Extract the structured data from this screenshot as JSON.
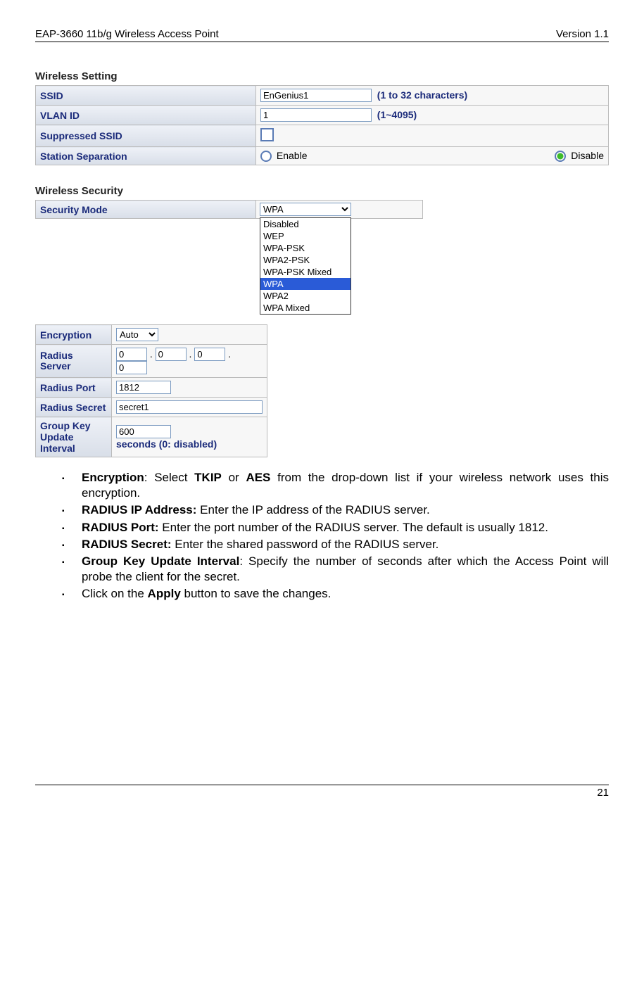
{
  "header": {
    "left": "EAP-3660  11b/g Wireless Access Point",
    "right": "Version 1.1"
  },
  "wireless_setting": {
    "title": "Wireless Setting",
    "ssid_label": "SSID",
    "ssid_value": "EnGenius1",
    "ssid_note": "(1 to 32 characters)",
    "vlan_label": "VLAN ID",
    "vlan_value": "1",
    "vlan_note": "(1~4095)",
    "suppressed_label": "Suppressed SSID",
    "separation_label": "Station Separation",
    "enable": "Enable",
    "disable": "Disable"
  },
  "wireless_security": {
    "title": "Wireless Security",
    "mode_label": "Security Mode",
    "mode_selected": "WPA",
    "mode_options": [
      "Disabled",
      "WEP",
      "WPA-PSK",
      "WPA2-PSK",
      "WPA-PSK Mixed",
      "WPA",
      "WPA2",
      "WPA Mixed"
    ],
    "encryption_label": "Encryption",
    "encryption_value": "Auto",
    "radius_server_label": "Radius Server",
    "radius_ip": [
      "0",
      "0",
      "0",
      ""
    ],
    "radius_ip_extra": "0",
    "radius_port_label": "Radius Port",
    "radius_port_value": "1812",
    "radius_secret_label": "Radius Secret",
    "radius_secret_value": "secret1",
    "gku_label_l1": "Group Key",
    "gku_label_l2": "Update",
    "gku_label_l3": "Interval",
    "gku_value": "600",
    "gku_note": "seconds (0: disabled)"
  },
  "bullets": {
    "b1a": "Encryption",
    "b1b": ": Select ",
    "b1c": "TKIP",
    "b1d": " or ",
    "b1e": "AES",
    "b1f": " from the drop-down list if your wireless network uses this encryption.",
    "b2a": "RADIUS IP Address:",
    "b2b": " Enter the IP address of the RADIUS server.",
    "b3a": "RADIUS Port:",
    "b3b": " Enter the port number of the RADIUS server. The default is usually 1812.",
    "b4a": "RADIUS Secret:",
    "b4b": " Enter the shared password of the RADIUS server.",
    "b5a": "Group Key Update Interval",
    "b5b": ": Specify the number of seconds after which the Access Point will probe the client for the secret.",
    "b6a": "Click on the ",
    "b6b": "Apply",
    "b6c": " button to save the changes."
  },
  "footer": {
    "page": "21"
  }
}
